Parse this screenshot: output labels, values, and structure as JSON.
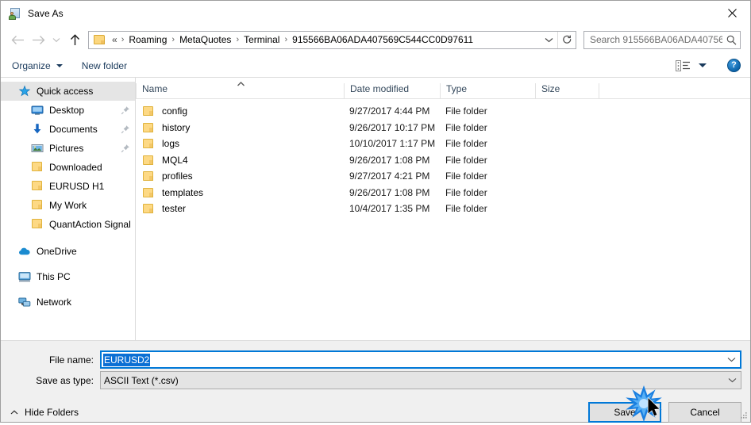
{
  "window": {
    "title": "Save As",
    "title_icon": "save-as-icon",
    "close_label": "close-icon"
  },
  "nav": {
    "back": "back-arrow-icon",
    "forward": "forward-arrow-icon",
    "recent": "recent-locations-chevron-icon",
    "up": "up-arrow-icon",
    "back_enabled": false,
    "forward_enabled": false
  },
  "address": {
    "folder_icon": "folder-icon",
    "overflow": "«",
    "crumbs": [
      "Roaming",
      "MetaQuotes",
      "Terminal",
      "915566BA06ADA407569C544CC0D97611"
    ],
    "separator": "›",
    "dropdown_icon": "chevron-down-icon",
    "refresh_icon": "refresh-icon"
  },
  "search": {
    "placeholder": "Search 915566BA06ADA40756...",
    "icon": "search-icon"
  },
  "toolbar": {
    "organize_label": "Organize",
    "new_folder_label": "New folder",
    "view_icon": "view-layout-icon",
    "view_caret_icon": "chevron-down-icon",
    "help_label": "?",
    "help_icon": "help-icon"
  },
  "sidebar": {
    "items": [
      {
        "label": "Quick access",
        "icon": "star-icon",
        "level": 0,
        "selected": true,
        "pinned": false
      },
      {
        "label": "Desktop",
        "icon": "desktop-icon",
        "level": 1,
        "selected": false,
        "pinned": true
      },
      {
        "label": "Documents",
        "icon": "documents-icon",
        "level": 1,
        "selected": false,
        "pinned": true
      },
      {
        "label": "Pictures",
        "icon": "pictures-icon",
        "level": 1,
        "selected": false,
        "pinned": true
      },
      {
        "label": "Downloaded",
        "icon": "folder-icon",
        "level": 1,
        "selected": false,
        "pinned": false
      },
      {
        "label": "EURUSD H1",
        "icon": "folder-icon",
        "level": 1,
        "selected": false,
        "pinned": false
      },
      {
        "label": "My Work",
        "icon": "folder-icon",
        "level": 1,
        "selected": false,
        "pinned": false
      },
      {
        "label": "QuantAction Signal",
        "icon": "folder-icon",
        "level": 1,
        "selected": false,
        "pinned": false
      },
      {
        "label": "OneDrive",
        "icon": "onedrive-icon",
        "level": 0,
        "selected": false,
        "pinned": false
      },
      {
        "label": "This PC",
        "icon": "this-pc-icon",
        "level": 0,
        "selected": false,
        "pinned": false
      },
      {
        "label": "Network",
        "icon": "network-icon",
        "level": 0,
        "selected": false,
        "pinned": false
      }
    ]
  },
  "filelist": {
    "columns": [
      "Name",
      "Date modified",
      "Type",
      "Size"
    ],
    "sort_column": "Name",
    "sort_direction": "ascending",
    "rows": [
      {
        "name": "config",
        "date": "9/27/2017 4:44 PM",
        "type": "File folder",
        "size": ""
      },
      {
        "name": "history",
        "date": "9/26/2017 10:17 PM",
        "type": "File folder",
        "size": ""
      },
      {
        "name": "logs",
        "date": "10/10/2017 1:17 PM",
        "type": "File folder",
        "size": ""
      },
      {
        "name": "MQL4",
        "date": "9/26/2017 1:08 PM",
        "type": "File folder",
        "size": ""
      },
      {
        "name": "profiles",
        "date": "9/27/2017 4:21 PM",
        "type": "File folder",
        "size": ""
      },
      {
        "name": "templates",
        "date": "9/26/2017 1:08 PM",
        "type": "File folder",
        "size": ""
      },
      {
        "name": "tester",
        "date": "10/4/2017 1:35 PM",
        "type": "File folder",
        "size": ""
      }
    ]
  },
  "form": {
    "filename_label": "File name:",
    "filename_value": "EURUSD2",
    "filename_selected": true,
    "savetype_label": "Save as type:",
    "savetype_value": "ASCII Text (*.csv)",
    "dropdown_icon": "chevron-down-icon"
  },
  "footer": {
    "hide_folders_label": "Hide Folders",
    "hide_folders_icon": "chevron-up-icon",
    "save_label": "Save",
    "cancel_label": "Cancel",
    "resize_grip": "resize-grip-icon"
  },
  "colors": {
    "accent": "#0078d7",
    "selection": "#0b6fd4",
    "folder": "#fdd985",
    "header_text": "#33475b",
    "click_burst": "#1a7fe0"
  },
  "interaction": {
    "cursor_icon": "mouse-pointer-icon",
    "click_effect": "click-burst",
    "target": "Save"
  }
}
